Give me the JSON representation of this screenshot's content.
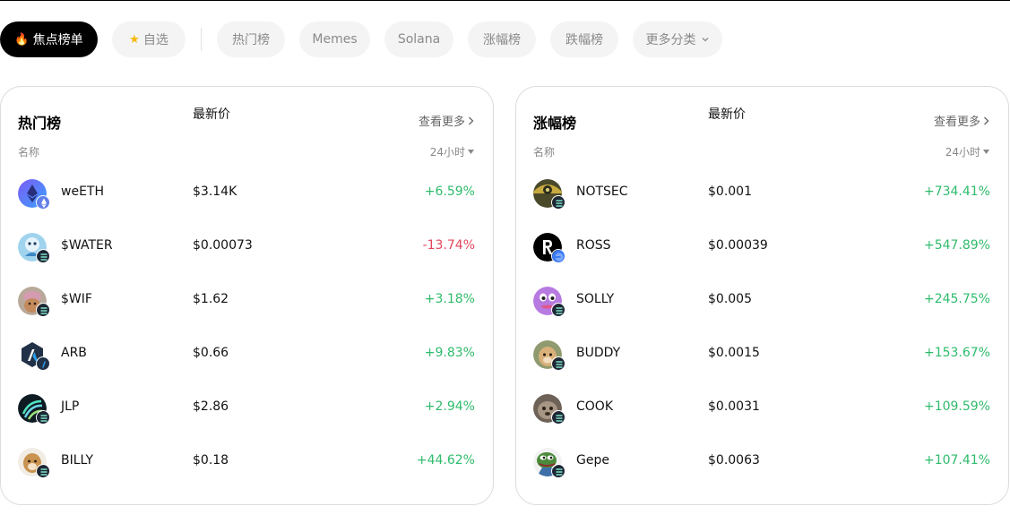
{
  "tabs": [
    {
      "label": "焦点榜单",
      "icon": "fire-icon",
      "active": true
    },
    {
      "label": "自选",
      "icon": "star-icon",
      "active": false
    },
    {
      "label": "热门榜",
      "active": false
    },
    {
      "label": "Memes",
      "active": false
    },
    {
      "label": "Solana",
      "active": false
    },
    {
      "label": "涨幅榜",
      "active": false
    },
    {
      "label": "跌幅榜",
      "active": false
    },
    {
      "label": "更多分类",
      "icon": "chevron-down-icon",
      "active": false
    }
  ],
  "colors": {
    "up": "#2fbb6c",
    "down": "#e0455c",
    "active_tab": "#000000"
  },
  "hot": {
    "title": "热门榜",
    "more": "查看更多",
    "headers": {
      "name": "名称",
      "price": "最新价",
      "period": "24小时"
    },
    "rows": [
      {
        "symbol": "weETH",
        "price": "$3.14K",
        "change": "+6.59%",
        "dir": "up",
        "chain": "ethereum-icon"
      },
      {
        "symbol": "$WATER",
        "price": "$0.00073",
        "change": "-13.74%",
        "dir": "down",
        "chain": "solana-icon"
      },
      {
        "symbol": "$WIF",
        "price": "$1.62",
        "change": "+3.18%",
        "dir": "up",
        "chain": "solana-icon"
      },
      {
        "symbol": "ARB",
        "price": "$0.66",
        "change": "+9.83%",
        "dir": "up",
        "chain": "arbitrum-icon"
      },
      {
        "symbol": "JLP",
        "price": "$2.86",
        "change": "+2.94%",
        "dir": "up",
        "chain": "solana-icon"
      },
      {
        "symbol": "BILLY",
        "price": "$0.18",
        "change": "+44.62%",
        "dir": "up",
        "chain": "solana-icon"
      }
    ]
  },
  "gainers": {
    "title": "涨幅榜",
    "more": "查看更多",
    "headers": {
      "name": "名称",
      "price": "最新价",
      "period": "24小时"
    },
    "rows": [
      {
        "symbol": "NOTSEC",
        "price": "$0.001",
        "change": "+734.41%",
        "dir": "up",
        "chain": "solana-icon"
      },
      {
        "symbol": "ROSS",
        "price": "$0.00039",
        "change": "+547.89%",
        "dir": "up",
        "chain": "base-icon"
      },
      {
        "symbol": "SOLLY",
        "price": "$0.005",
        "change": "+245.75%",
        "dir": "up",
        "chain": "solana-icon"
      },
      {
        "symbol": "BUDDY",
        "price": "$0.0015",
        "change": "+153.67%",
        "dir": "up",
        "chain": "solana-icon"
      },
      {
        "symbol": "COOK",
        "price": "$0.0031",
        "change": "+109.59%",
        "dir": "up",
        "chain": "solana-icon"
      },
      {
        "symbol": "Gepe",
        "price": "$0.0063",
        "change": "+107.41%",
        "dir": "up",
        "chain": "solana-icon"
      }
    ]
  }
}
